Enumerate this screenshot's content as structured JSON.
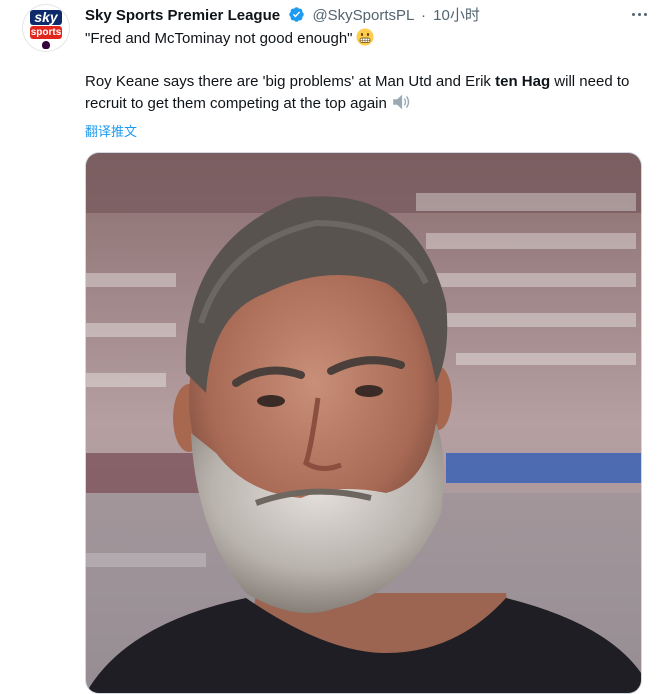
{
  "tweet": {
    "display_name": "Sky Sports Premier League",
    "handle": "@SkySportsPL",
    "separator": "·",
    "time": "10小时",
    "quote": "\"Fred and McTominay not good enough\"",
    "body_part1": "Roy Keane says there are 'big problems' at Man Utd and Erik ",
    "body_bold": "ten Hag",
    "body_part2": " will need to recruit to get them competing at the top again",
    "translate_label": "翻译推文"
  },
  "avatar": {
    "logo_top": "sky",
    "logo_bottom": "sports"
  },
  "icons": {
    "verified": "verified-badge-icon",
    "more": "more-options-icon",
    "grimace_emoji": "grimacing-face-emoji",
    "speaker_emoji": "speaker-emoji"
  },
  "colors": {
    "link": "#1d9bf0",
    "muted": "#536471",
    "text": "#0f1419",
    "sky_blue": "#0f2a6b",
    "sky_red": "#e1261c"
  }
}
